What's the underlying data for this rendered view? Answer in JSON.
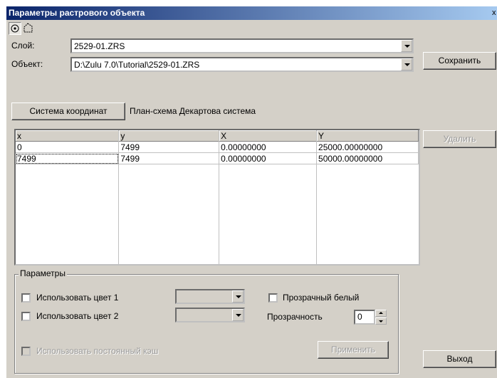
{
  "window": {
    "title": "Параметры растрового объекта",
    "close_glyph": "x"
  },
  "toolbar": {
    "icons": [
      "point-target-icon",
      "polygon-select-icon"
    ]
  },
  "layer": {
    "label": "Слой:",
    "value": "2529-01.ZRS"
  },
  "object": {
    "label": "Объект:",
    "value": "D:\\Zulu 7.0\\Tutorial\\2529-01.ZRS"
  },
  "coords": {
    "button": "Система координат",
    "value": "План-схема Декартова система"
  },
  "buttons": {
    "save": "Сохранить",
    "delete": "Удалить",
    "exit": "Выход",
    "apply": "Применить"
  },
  "grid": {
    "headers": [
      "x",
      "y",
      "X",
      "Y"
    ],
    "rows": [
      [
        "0",
        "7499",
        "0.00000000",
        "25000.00000000"
      ],
      [
        "7499",
        "7499",
        "0.00000000",
        "50000.00000000"
      ]
    ]
  },
  "params": {
    "title": "Параметры",
    "use_color1": "Использовать цвет 1",
    "use_color2": "Использовать цвет 2",
    "transparent_white": "Прозрачный белый",
    "transparency_label": "Прозрачность",
    "transparency_value": "0",
    "permanent_cache": "Использовать постоянный кэш"
  }
}
